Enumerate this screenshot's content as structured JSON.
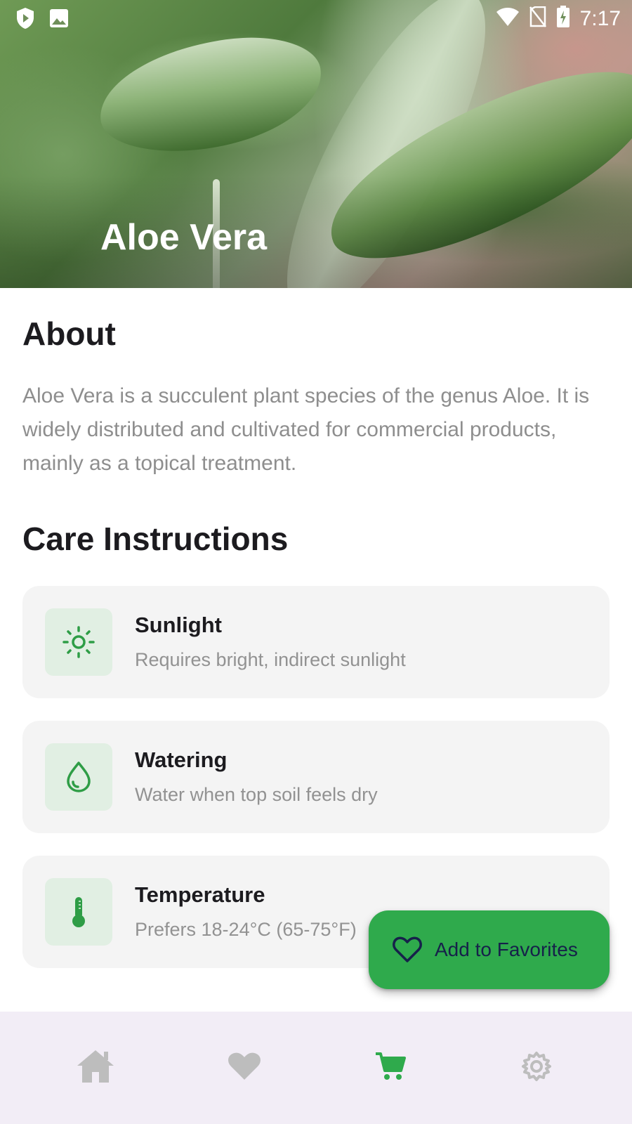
{
  "status_bar": {
    "time": "7:17",
    "left_icons": [
      "shield-icon",
      "image-icon"
    ],
    "right_icons": [
      "wifi-icon",
      "no-sim-icon",
      "battery-charging-icon"
    ]
  },
  "hero": {
    "title": "Aloe Vera"
  },
  "about": {
    "heading": "About",
    "text": "Aloe Vera is a succulent plant species of the genus Aloe. It is widely distributed and cultivated for commercial products, mainly as a topical treatment."
  },
  "care": {
    "heading": "Care Instructions",
    "items": [
      {
        "title": "Sunlight",
        "description": "Requires bright, indirect sunlight",
        "icon": "sun-icon"
      },
      {
        "title": "Watering",
        "description": "Water when top soil feels dry",
        "icon": "water-drop-icon"
      },
      {
        "title": "Temperature",
        "description": "Prefers 18-24°C (65-75°F)",
        "icon": "thermometer-icon"
      }
    ]
  },
  "fab": {
    "label": "Add to Favorites",
    "icon": "heart-outline-icon"
  },
  "bottom_nav": {
    "items": [
      {
        "icon": "home-icon",
        "active": false
      },
      {
        "icon": "heart-icon",
        "active": false
      },
      {
        "icon": "cart-icon",
        "active": true
      },
      {
        "icon": "settings-icon",
        "active": false
      }
    ]
  },
  "colors": {
    "accent_green": "#2faa4c",
    "card_bg": "#f4f4f4",
    "icon_box_bg": "#e1efe3",
    "nav_bg": "#f2edf6",
    "inactive_icon": "#bdbdbd"
  }
}
